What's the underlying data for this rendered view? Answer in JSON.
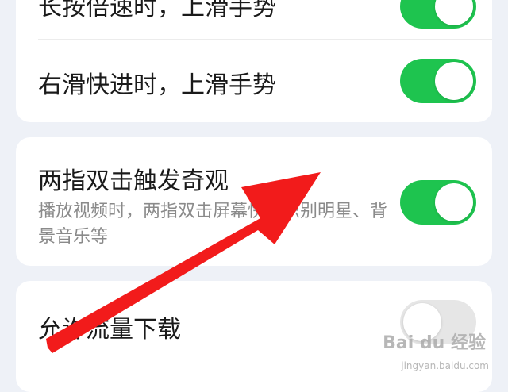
{
  "colors": {
    "toggle_on": "#1ec44f",
    "toggle_off": "#e6e6e6",
    "annotation_arrow": "#f21b1b"
  },
  "settings": [
    {
      "label": "长按倍速时，上滑手势",
      "enabled": true
    },
    {
      "label": "右滑快进时，上滑手势",
      "enabled": true
    },
    {
      "label": "两指双击触发奇观",
      "description": "播放视频时，两指双击屏幕快速识别明星、背景音乐等",
      "enabled": true
    },
    {
      "label": "允许流量下载",
      "enabled": false
    }
  ],
  "watermark": {
    "text": "Bai du 经验",
    "subtext": "jingyan.baidu.com"
  }
}
